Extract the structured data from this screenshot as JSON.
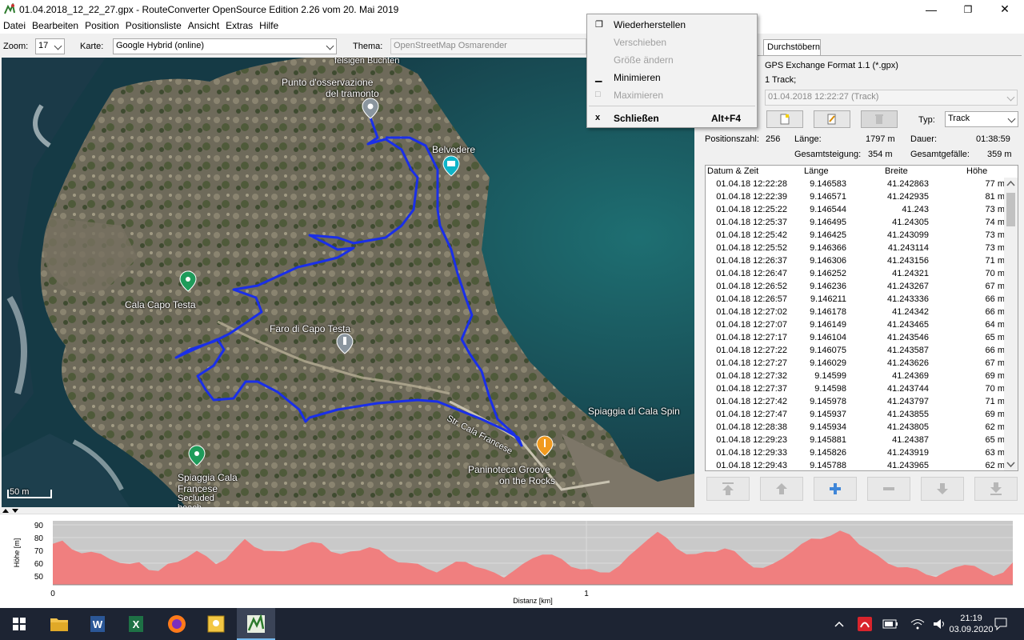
{
  "window": {
    "title": "01.04.2018_12_22_27.gpx - RouteConverter OpenSource Edition 2.26 vom 20. Mai 2019",
    "min": "—",
    "max": "❐",
    "close": "✕"
  },
  "menu": [
    "Datei",
    "Bearbeiten",
    "Position",
    "Positionsliste",
    "Ansicht",
    "Extras",
    "Hilfe"
  ],
  "toolbar": {
    "zoom_label": "Zoom:",
    "zoom_value": "17",
    "map_label": "Karte:",
    "map_value": "Google Hybrid (online)",
    "theme_label": "Thema:",
    "theme_value": "OpenStreetMap Osmarender"
  },
  "map": {
    "labels": [
      "felsigen Buchten",
      "Punto d'osservazione",
      "del tramonto",
      "Belvedere",
      "Cala Capo Testa",
      "Faro di Capo Testa",
      "Spiaggia di Cala Spin",
      "Str. Cala Francese",
      "Paninoteca Groove",
      "on the Rocks",
      "Spiaggia Cala",
      "Francese",
      "Secluded",
      "beach"
    ],
    "scale": "50 m"
  },
  "panel": {
    "tab": "Durchstöbern",
    "format": "GPS Exchange Format 1.1 (*.gpx)",
    "tracks": "1 Track;",
    "track_select": "01.04.2018 12:22:27 (Track)",
    "type_label": "Typ:",
    "type_value": "Track",
    "stats": {
      "positions_label": "Positionszahl:",
      "positions": "256",
      "length_label": "Länge:",
      "length": "1797 m",
      "duration_label": "Dauer:",
      "duration": "01:38:59",
      "ascent_label": "Gesamtsteigung:",
      "ascent": "354 m",
      "descent_label": "Gesamtgefälle:",
      "descent": "359 m"
    }
  },
  "table": {
    "headers": [
      "Datum & Zeit",
      "Länge",
      "Breite",
      "Höhe"
    ],
    "rows": [
      [
        "01.04.18 12:22:28",
        "9.146583",
        "41.242863",
        "77 m"
      ],
      [
        "01.04.18 12:22:39",
        "9.146571",
        "41.242935",
        "81 m"
      ],
      [
        "01.04.18 12:25:22",
        "9.146544",
        "41.243",
        "73 m"
      ],
      [
        "01.04.18 12:25:37",
        "9.146495",
        "41.24305",
        "74 m"
      ],
      [
        "01.04.18 12:25:42",
        "9.146425",
        "41.243099",
        "73 m"
      ],
      [
        "01.04.18 12:25:52",
        "9.146366",
        "41.243114",
        "73 m"
      ],
      [
        "01.04.18 12:26:37",
        "9.146306",
        "41.243156",
        "71 m"
      ],
      [
        "01.04.18 12:26:47",
        "9.146252",
        "41.24321",
        "70 m"
      ],
      [
        "01.04.18 12:26:52",
        "9.146236",
        "41.243267",
        "67 m"
      ],
      [
        "01.04.18 12:26:57",
        "9.146211",
        "41.243336",
        "66 m"
      ],
      [
        "01.04.18 12:27:02",
        "9.146178",
        "41.24342",
        "66 m"
      ],
      [
        "01.04.18 12:27:07",
        "9.146149",
        "41.243465",
        "64 m"
      ],
      [
        "01.04.18 12:27:17",
        "9.146104",
        "41.243546",
        "65 m"
      ],
      [
        "01.04.18 12:27:22",
        "9.146075",
        "41.243587",
        "66 m"
      ],
      [
        "01.04.18 12:27:27",
        "9.146029",
        "41.243626",
        "67 m"
      ],
      [
        "01.04.18 12:27:32",
        "9.14599",
        "41.24369",
        "69 m"
      ],
      [
        "01.04.18 12:27:37",
        "9.14598",
        "41.243744",
        "70 m"
      ],
      [
        "01.04.18 12:27:42",
        "9.145978",
        "41.243797",
        "71 m"
      ],
      [
        "01.04.18 12:27:47",
        "9.145937",
        "41.243855",
        "69 m"
      ],
      [
        "01.04.18 12:28:38",
        "9.145934",
        "41.243805",
        "62 m"
      ],
      [
        "01.04.18 12:29:23",
        "9.145881",
        "41.24387",
        "65 m"
      ],
      [
        "01.04.18 12:29:33",
        "9.145826",
        "41.243919",
        "63 m"
      ],
      [
        "01.04.18 12:29:43",
        "9.145788",
        "41.243965",
        "62 m"
      ]
    ]
  },
  "elevation": {
    "y_title": "Höhe [m]",
    "x_title": "Distanz [km]",
    "y_ticks": [
      "90",
      "80",
      "70",
      "60",
      "50"
    ],
    "x_ticks": [
      "0",
      "1"
    ],
    "fill_color": "#f07f7f"
  },
  "context_menu": {
    "items": [
      {
        "label": "Wiederherstellen",
        "icon": "restore-icon",
        "glyph": "❐",
        "enabled": true
      },
      {
        "label": "Verschieben",
        "icon": "",
        "glyph": "",
        "enabled": false
      },
      {
        "label": "Größe ändern",
        "icon": "",
        "glyph": "",
        "enabled": false
      },
      {
        "label": "Minimieren",
        "icon": "minimize-icon",
        "glyph": "▁",
        "enabled": true
      },
      {
        "label": "Maximieren",
        "icon": "maximize-icon",
        "glyph": "□",
        "enabled": false
      },
      {
        "label": "Schließen",
        "icon": "close-icon",
        "glyph": "x",
        "shortcut": "Alt+F4",
        "enabled": true,
        "bold": true
      }
    ]
  },
  "taskbar": {
    "time": "21:19",
    "date": "03.09.2020"
  },
  "colors": {
    "track": "#1a2fe8",
    "taskbar": "#1d2433",
    "elevation_bg": "#c9c9c9"
  }
}
